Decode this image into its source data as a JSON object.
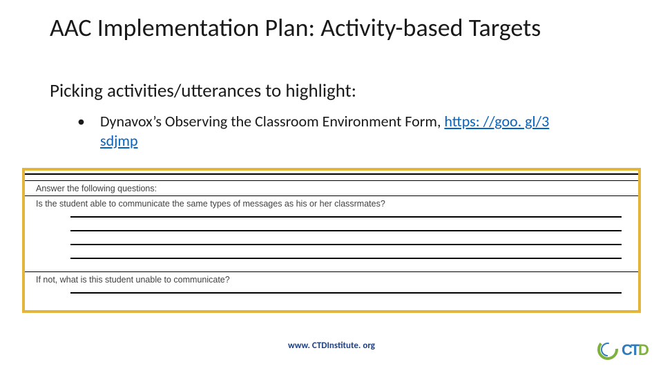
{
  "title": "AAC Implementation Plan: Activity-based Targets",
  "subhead": "Picking activities/utterances to highlight:",
  "bullet": {
    "text": "Dynavox’s Observing the Classroom Environment Form, ",
    "link_text": "https: //goo. gl/3 sdjmp"
  },
  "form": {
    "heading": "Answer the following questions:",
    "q1": "Is the student able to communicate  the same types of messages as his or her classrmates?",
    "q2": "If not, what is this student unable to communicate?"
  },
  "footer": "www. CTDInstitute. org"
}
